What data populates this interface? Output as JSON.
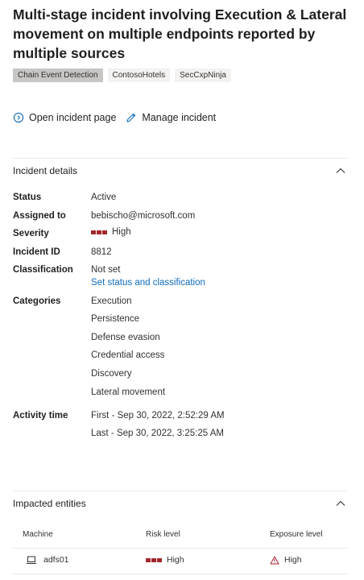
{
  "incident": {
    "title": "Multi-stage incident involving Execution & Lateral movement on multiple endpoints reported by multiple sources",
    "tags": [
      "Chain Event Detection",
      "ContosoHotels",
      "SecCxpNinja"
    ]
  },
  "actions": {
    "open_label": "Open incident page",
    "manage_label": "Manage incident"
  },
  "details": {
    "section_title": "Incident details",
    "status_label": "Status",
    "status_value": "Active",
    "assigned_label": "Assigned to",
    "assigned_value": "bebischo@microsoft.com",
    "severity_label": "Severity",
    "severity_value": "High",
    "id_label": "Incident ID",
    "id_value": "8812",
    "classification_label": "Classification",
    "classification_value": "Not set",
    "classification_link": "Set status and classification",
    "categories_label": "Categories",
    "categories": [
      "Execution",
      "Persistence",
      "Defense evasion",
      "Credential access",
      "Discovery",
      "Lateral movement"
    ],
    "activity_label": "Activity time",
    "activity_first": "First - Sep 30, 2022, 2:52:29 AM",
    "activity_last": "Last - Sep 30, 2022, 3:25:25 AM"
  },
  "entities": {
    "section_title": "Impacted entities",
    "columns": [
      "Machine",
      "Risk level",
      "Exposure level"
    ],
    "rows": [
      {
        "machine": "adfs01",
        "risk": "High",
        "exposure": "High"
      }
    ]
  },
  "colors": {
    "severity_high": "#a4262c",
    "link": "#0f6cbd",
    "warning": "#a4262c"
  },
  "icons": [
    "chevron-right-circle-icon",
    "pencil-icon",
    "chevron-up-icon",
    "laptop-icon",
    "warning-triangle-icon"
  ]
}
